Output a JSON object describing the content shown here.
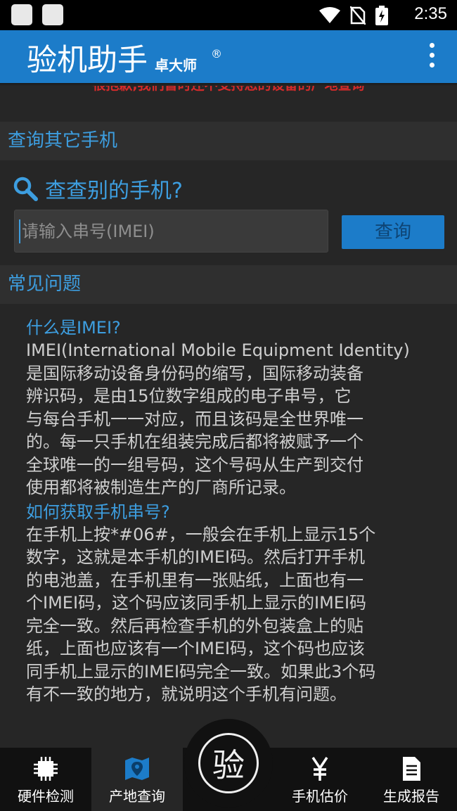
{
  "status_bar": {
    "time": "2:35"
  },
  "app_bar": {
    "title": "验机助手",
    "subtitle": "卓大师",
    "registered": "®"
  },
  "notice": "很抱歉,我们暂时还不支持您的设备的产地查询",
  "sections": {
    "query_other": "查询其它手机",
    "faq": "常见问题"
  },
  "search": {
    "heading": "查查别的手机?",
    "placeholder": "请输入串号(IMEI)",
    "button_label": "查询"
  },
  "faq": [
    {
      "question": "什么是IMEI?",
      "answer": "IMEI(International Mobile Equipment Identity)\n是国际移动设备身份码的缩写，国际移动装备\n辨识码，是由15位数字组成的电子串号，它\n与每台手机一一对应，而且该码是全世界唯一\n的。每一只手机在组装完成后都将被赋予一个\n全球唯一的一组号码，这个号码从生产到交付\n使用都将被制造生产的厂商所记录。"
    },
    {
      "question": "如何获取手机串号?",
      "answer": "在手机上按*#06#，一般会在手机上显示15个\n数字，这就是本手机的IMEI码。然后打开手机\n的电池盖，在手机里有一张贴纸，上面也有一\n个IMEI码，这个码应该同手机上显示的IMEI码\n完全一致。然后再检查手机的外包装盒上的贴\n纸，上面也应该有一个IMEI码，这个码也应该\n同手机上显示的IMEI码完全一致。如果此3个码\n有不一致的地方，就说明这个手机有问题。"
    }
  ],
  "bottom_nav": {
    "items": [
      {
        "label": "硬件检测",
        "icon": "chip-icon"
      },
      {
        "label": "产地查询",
        "icon": "map-pin-icon"
      },
      {
        "label": "手机估价",
        "icon": "yen-icon"
      },
      {
        "label": "生成报告",
        "icon": "document-icon"
      }
    ],
    "center_label": "验"
  },
  "colors": {
    "accent": "#1c7cc9",
    "link": "#3d9ee0",
    "warning": "#d52b2b",
    "background": "#262626"
  }
}
